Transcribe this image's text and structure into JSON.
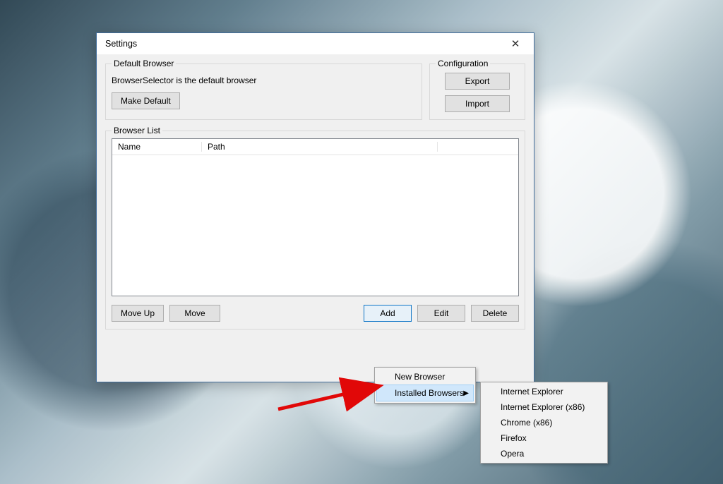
{
  "window": {
    "title": "Settings",
    "close_glyph": "✕"
  },
  "defaultBrowser": {
    "legend": "Default Browser",
    "status": "BrowserSelector is the default browser",
    "make_default": "Make Default"
  },
  "configuration": {
    "legend": "Configuration",
    "export": "Export",
    "import": "Import"
  },
  "browserList": {
    "legend": "Browser List",
    "col_name": "Name",
    "col_path": "Path",
    "rows": []
  },
  "buttons": {
    "move_up": "Move Up",
    "move_down": "Move",
    "add": "Add",
    "edit": "Edit",
    "delete": "Delete"
  },
  "addMenu": {
    "new_browser": "New Browser",
    "installed": "Installed Browsers"
  },
  "installedMenu": {
    "items": [
      "Internet Explorer",
      "Internet Explorer (x86)",
      "Chrome (x86)",
      "Firefox",
      "Opera"
    ]
  }
}
